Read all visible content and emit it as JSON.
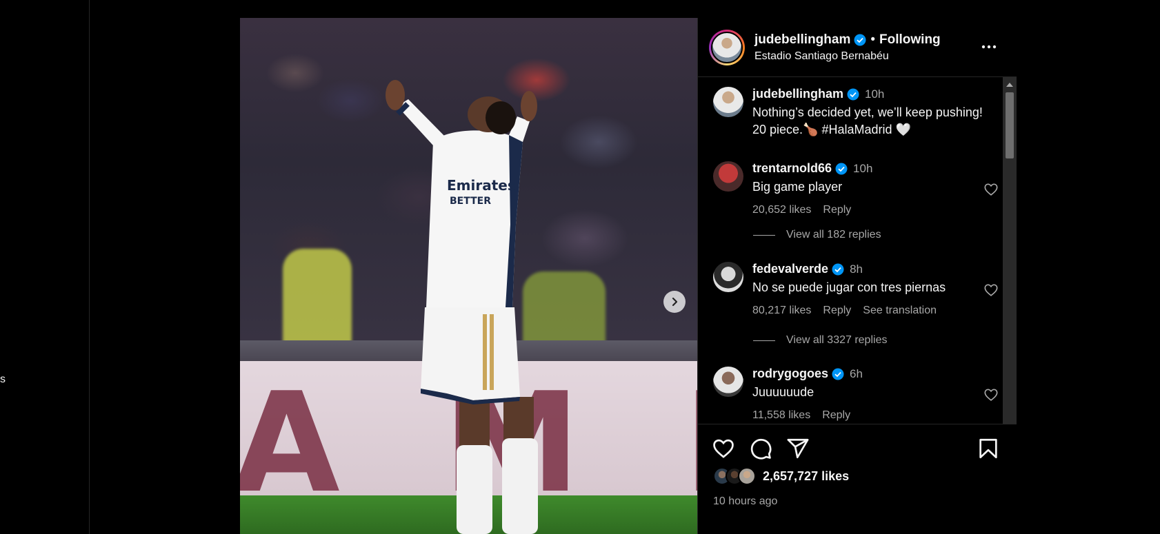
{
  "page": {
    "left_text": "s"
  },
  "post": {
    "username": "judebellingham",
    "following": "Following",
    "separator": "•",
    "location": "Estadio Santiago Bernabéu",
    "board_text": "A M H O",
    "likes": "2,657,727 likes",
    "time_ago": "10 hours ago"
  },
  "caption": {
    "username": "judebellingham",
    "time": "10h",
    "text": "Nothing’s decided yet, we’ll keep pushing! 20 piece.🍗 #HalaMadrid 🤍"
  },
  "comments": [
    {
      "username": "trentarnold66",
      "time": "10h",
      "text": "Big game player",
      "likes": "20,652 likes",
      "reply": "Reply",
      "view_replies": "View all 182 replies"
    },
    {
      "username": "fedevalverde",
      "time": "8h",
      "text": "No se puede jugar con tres piernas",
      "likes": "80,217 likes",
      "reply": "Reply",
      "translate": "See translation",
      "view_replies": "View all 3327 replies"
    },
    {
      "username": "rodrygogoes",
      "time": "6h",
      "text": "Juuuuuude",
      "likes": "11,558 likes",
      "reply": "Reply"
    }
  ],
  "colors": {
    "verified": "#0095f6",
    "muted": "#a8a8a8",
    "divider": "#262626"
  },
  "icons": [
    "more-icon",
    "verified-icon",
    "heart-icon",
    "comment-icon",
    "share-icon",
    "bookmark-icon",
    "chevron-right-icon"
  ]
}
